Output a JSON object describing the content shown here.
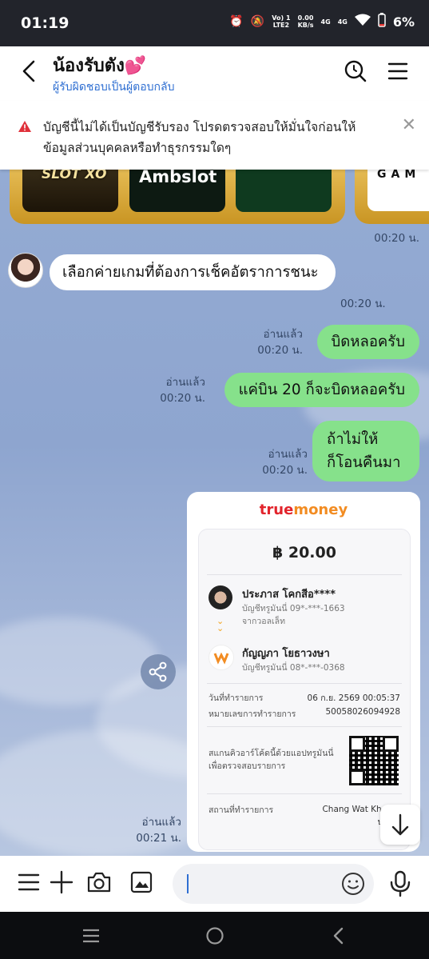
{
  "status": {
    "time": "01:19",
    "net_top": "Vo) 1",
    "net_bottom": "LTE2",
    "speed_top": "0.00",
    "speed_bottom": "KB/s",
    "sig1": "4G",
    "sig2": "4G",
    "battery": "6%"
  },
  "header": {
    "title": "น้องรับตัง💕",
    "subtitle": "ผู้รับผิดชอบเป็นผู้ตอบกลับ"
  },
  "warning": {
    "text": "บัญชีนี้ไม่ได้เป็นบัญชีรับรอง โปรดตรวจสอบให้มั่นใจก่อนให้ข้อมูลส่วนบุคคลหรือทำธุรกรรมใดๆ",
    "close": "✕"
  },
  "carousel": {
    "tile1": "SLOT XO",
    "tile2": "Ambslot",
    "tile4": "GAM",
    "time": "00:20 น."
  },
  "messages": [
    {
      "side": "in",
      "text": "เลือกค่ายเกมที่ต้องการเช็คอัตราการชนะ",
      "time": "00:20 น."
    },
    {
      "side": "out",
      "read": "อ่านแล้ว",
      "text": "บิดหลอครับ",
      "time": "00:20 น."
    },
    {
      "side": "out",
      "read": "อ่านแล้ว",
      "text": "แค่บิน 20 ก็จะบิดหลอครับ",
      "time": "00:20 น."
    },
    {
      "side": "out",
      "read": "อ่านแล้ว",
      "text": "ถ้าไม่ให้\nก็โอนคืนมา",
      "time": "00:20 น."
    }
  ],
  "receipt": {
    "read": "อ่านแล้ว",
    "time": "00:21 น.",
    "logo_a": "true",
    "logo_b": "money",
    "amount": "฿ 20.00",
    "sender_name": "ประภาส โคกสีอ****",
    "sender_acct": "บัญชีทรูมันนี่ 09*-***-1663",
    "sender_src": "จากวอลเล็ท",
    "receiver_name": "กัญญภา โยธาวงษา",
    "receiver_acct": "บัญชีทรูมันนี่ 08*-***-0368",
    "date_label": "วันที่ทำรายการ",
    "date_value": "06 ก.ย. 2569 00:05:37",
    "ref_label": "หมายเลขการทำรายการ",
    "ref_value": "50058026094928",
    "qr_text": "สแกนคิวอาร์โค้ดนี้ด้วยแอปทรูมันนี่เพื่อตรวจสอบรายการ",
    "place_label": "สถานที่ทำรายการ",
    "place_value": "Chang Wat Khon K",
    "place_value2": "ประเท"
  },
  "colors": {
    "outgoing": "#86e18b",
    "incoming": "#ffffff",
    "chat_bg": "#8fa7cf",
    "link": "#2f6fd2"
  }
}
